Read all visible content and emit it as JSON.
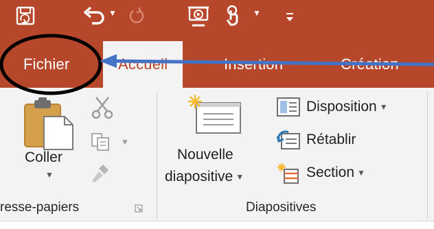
{
  "quick_access": {
    "items": [
      {
        "icon": "save-icon"
      },
      {
        "icon": "undo-icon"
      },
      {
        "icon": "redo-icon"
      },
      {
        "icon": "start-from-beginning-icon"
      },
      {
        "icon": "touch-mode-icon"
      },
      {
        "icon": "customize-toolbar-icon"
      }
    ]
  },
  "tabs": {
    "file": "Fichier",
    "home": "Accueil",
    "insert": "Insertion",
    "design": "Création"
  },
  "clipboard": {
    "paste_label": "Coller",
    "group_label": "resse-papiers"
  },
  "slides": {
    "new_slide_line1": "Nouvelle",
    "new_slide_line2": "diapositive",
    "layout_label": "Disposition",
    "reset_label": "Rétablir",
    "section_label": "Section",
    "group_label": "Diapositives"
  },
  "colors": {
    "accent": "#b7472a",
    "ribbon_bg": "#f3f3f3",
    "annotation_arrow": "#4472c4",
    "annotation_circle": "#000000"
  }
}
